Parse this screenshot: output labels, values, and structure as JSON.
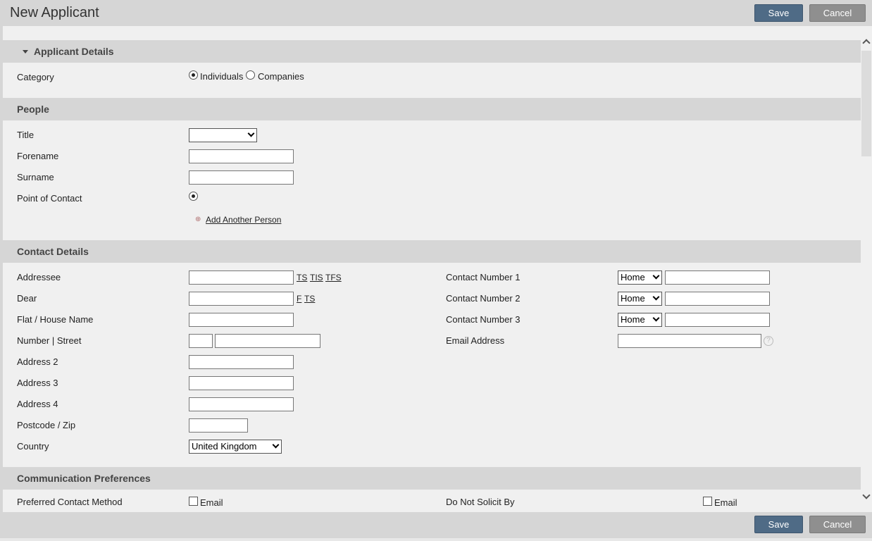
{
  "header": {
    "title": "New Applicant",
    "save_label": "Save",
    "cancel_label": "Cancel"
  },
  "footer": {
    "save_label": "Save",
    "cancel_label": "Cancel"
  },
  "applicant_details": {
    "heading": "Applicant Details",
    "category_label": "Category",
    "category_options": [
      "Individuals",
      "Companies"
    ],
    "category_selected": "Individuals"
  },
  "people": {
    "heading": "People",
    "title_label": "Title",
    "title_value": "",
    "forename_label": "Forename",
    "forename_value": "",
    "surname_label": "Surname",
    "surname_value": "",
    "point_of_contact_label": "Point of Contact",
    "add_person_label": "Add Another Person"
  },
  "contact_details": {
    "heading": "Contact Details",
    "addressee_label": "Addressee",
    "addressee_links": [
      "TS",
      "TIS",
      "TFS"
    ],
    "dear_label": "Dear",
    "dear_links": [
      "F",
      "TS"
    ],
    "flat_label": "Flat / House Name",
    "number_street_label": "Number | Street",
    "address2_label": "Address 2",
    "address3_label": "Address 3",
    "address4_label": "Address 4",
    "postcode_label": "Postcode / Zip",
    "country_label": "Country",
    "country_value": "United Kingdom",
    "contact1_label": "Contact Number 1",
    "contact1_type": "Home",
    "contact2_label": "Contact Number 2",
    "contact2_type": "Home",
    "contact3_label": "Contact Number 3",
    "contact3_type": "Home",
    "email_label": "Email Address",
    "help_glyph": "?"
  },
  "communication": {
    "heading": "Communication Preferences",
    "preferred_label": "Preferred Contact Method",
    "preferred_option": "Email",
    "do_not_solicit_label": "Do Not Solicit By",
    "do_not_solicit_option": "Email"
  },
  "icons": {
    "caret": "caret-down-icon",
    "plus": "plus-icon",
    "help": "help-icon"
  }
}
